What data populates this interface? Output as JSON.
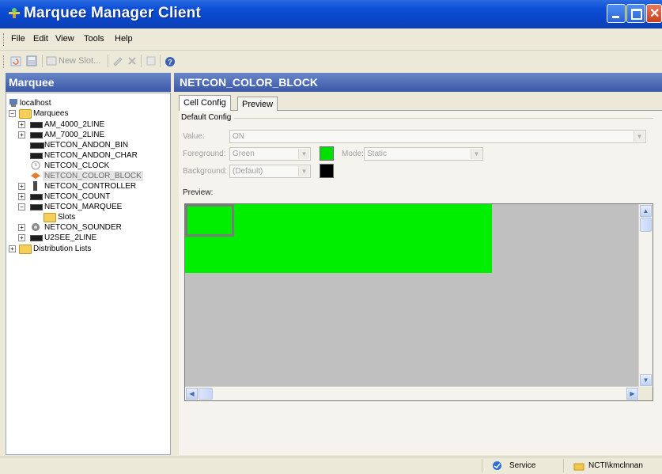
{
  "window": {
    "title": "Marquee Manager Client"
  },
  "menu": {
    "items": [
      "File",
      "Edit",
      "View",
      "Tools",
      "Help"
    ]
  },
  "toolbar": {
    "new_slot_label": "New Slot..."
  },
  "left_pane": {
    "header": "Marquee",
    "tree": {
      "root": "localhost",
      "marquees_label": "Marquees",
      "items": [
        "AM_4000_2LINE",
        "AM_7000_2LINE",
        "NETCON_ANDON_BIN",
        "NETCON_ANDON_CHAR",
        "NETCON_CLOCK",
        "NETCON_COLOR_BLOCK",
        "NETCON_CONTROLLER",
        "NETCON_COUNT",
        "NETCON_MARQUEE",
        "NETCON_SOUNDER",
        "U2SEE_2LINE"
      ],
      "slots_label": "Slots",
      "distribution_label": "Distribution Lists",
      "selected": "NETCON_COLOR_BLOCK"
    }
  },
  "right_pane": {
    "header": "NETCON_COLOR_BLOCK",
    "tabs": [
      "Cell Config",
      "Preview"
    ],
    "active_tab": "Cell Config",
    "group_label": "Default Config",
    "value_label": "Value:",
    "value": "ON",
    "foreground_label": "Foreground:",
    "foreground_value": "Green",
    "foreground_color": "#00e000",
    "mode_label": "Mode:",
    "mode_value": "Static",
    "background_label": "Background:",
    "background_value": "(Default)",
    "background_color": "#000000",
    "preview_label": "Preview:",
    "preview_fill_color": "#00ee00"
  },
  "statusbar": {
    "service": "Service",
    "user": "NCTI\\kmclnnan"
  }
}
